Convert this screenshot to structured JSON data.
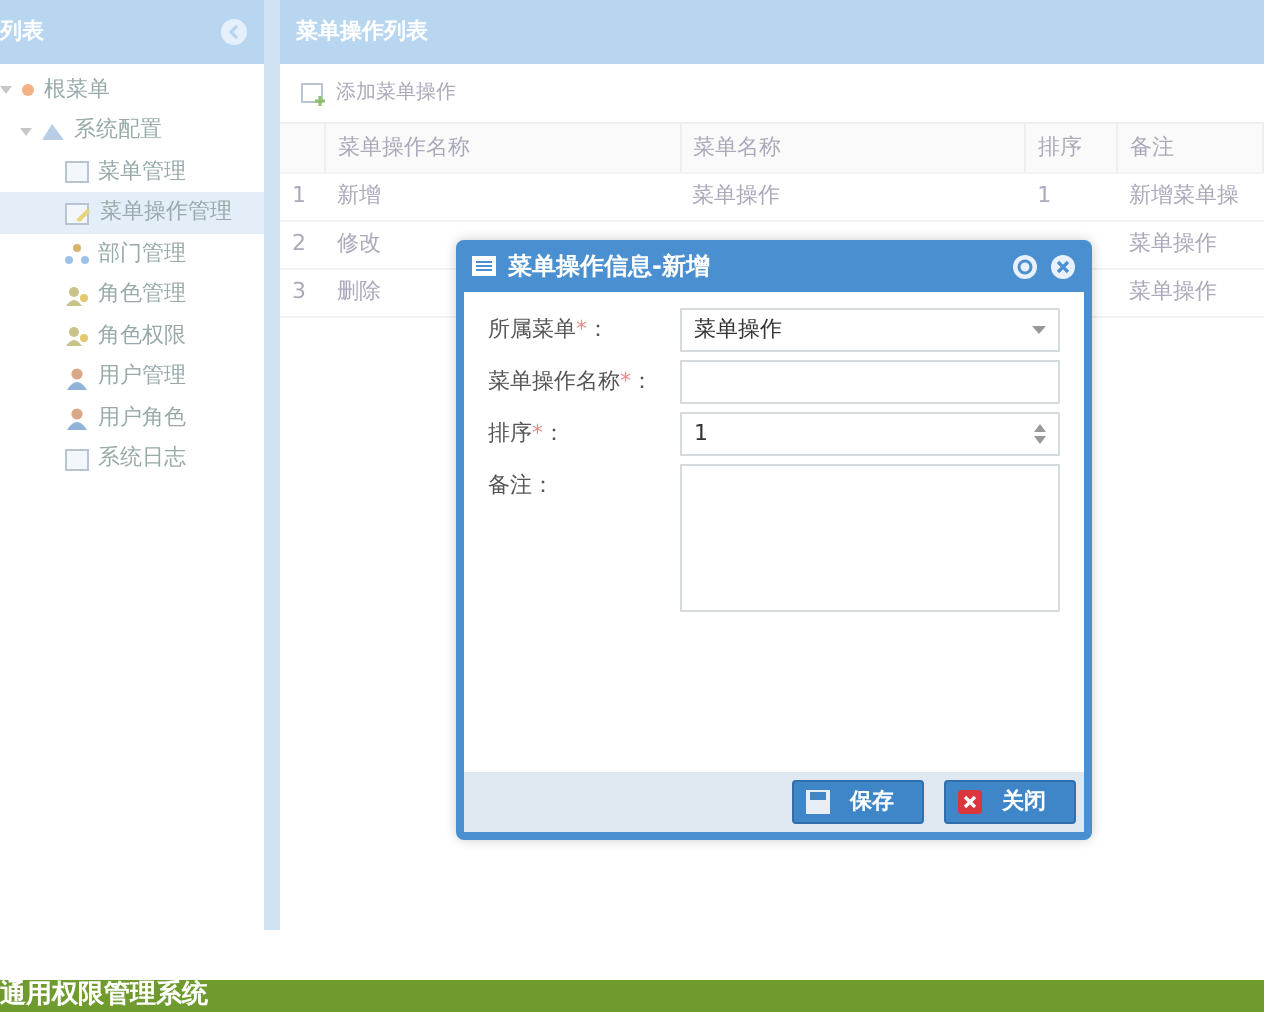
{
  "sidebar": {
    "title": "列表",
    "tree": [
      {
        "label": "根菜单",
        "kind": "root",
        "expanded": true,
        "children": [
          {
            "label": "系统配置",
            "kind": "folder",
            "expanded": true,
            "children": [
              {
                "label": "菜单管理",
                "kind": "page",
                "selected": false
              },
              {
                "label": "菜单操作管理",
                "kind": "page-edit",
                "selected": true
              },
              {
                "label": "部门管理",
                "kind": "org",
                "selected": false
              },
              {
                "label": "角色管理",
                "kind": "role",
                "selected": false
              },
              {
                "label": "角色权限",
                "kind": "role",
                "selected": false
              },
              {
                "label": "用户管理",
                "kind": "user",
                "selected": false
              },
              {
                "label": "用户角色",
                "kind": "user",
                "selected": false
              },
              {
                "label": "系统日志",
                "kind": "page",
                "selected": false
              }
            ]
          }
        ]
      }
    ]
  },
  "main": {
    "title": "菜单操作列表",
    "toolbar": {
      "add_button": "添加菜单操作"
    },
    "table": {
      "columns": [
        "菜单操作名称",
        "菜单名称",
        "排序",
        "备注"
      ],
      "rows": [
        {
          "index": "1",
          "cells": [
            "新增",
            "菜单操作",
            "1",
            "新增菜单操"
          ]
        },
        {
          "index": "2",
          "cells": [
            "修改",
            "",
            "",
            "菜单操作"
          ]
        },
        {
          "index": "3",
          "cells": [
            "删除",
            "",
            "",
            "菜单操作"
          ]
        }
      ]
    }
  },
  "dialog": {
    "title": "菜单操作信息-新增",
    "fields": [
      {
        "kind": "select",
        "label": "所属菜单",
        "required_mark": "*",
        "suffix": "：",
        "value": "菜单操作"
      },
      {
        "kind": "text",
        "label": "菜单操作名称",
        "required_mark": "*",
        "suffix": "："
      },
      {
        "kind": "number",
        "label": "排序",
        "required_mark": "*",
        "suffix": "：",
        "value": "1"
      },
      {
        "kind": "textarea",
        "label": "备注",
        "suffix": "："
      }
    ],
    "buttons": [
      {
        "kind": "save",
        "label": "保存"
      },
      {
        "kind": "close",
        "label": "关闭"
      }
    ]
  },
  "footer": {
    "title": "通用权限管理系统"
  }
}
